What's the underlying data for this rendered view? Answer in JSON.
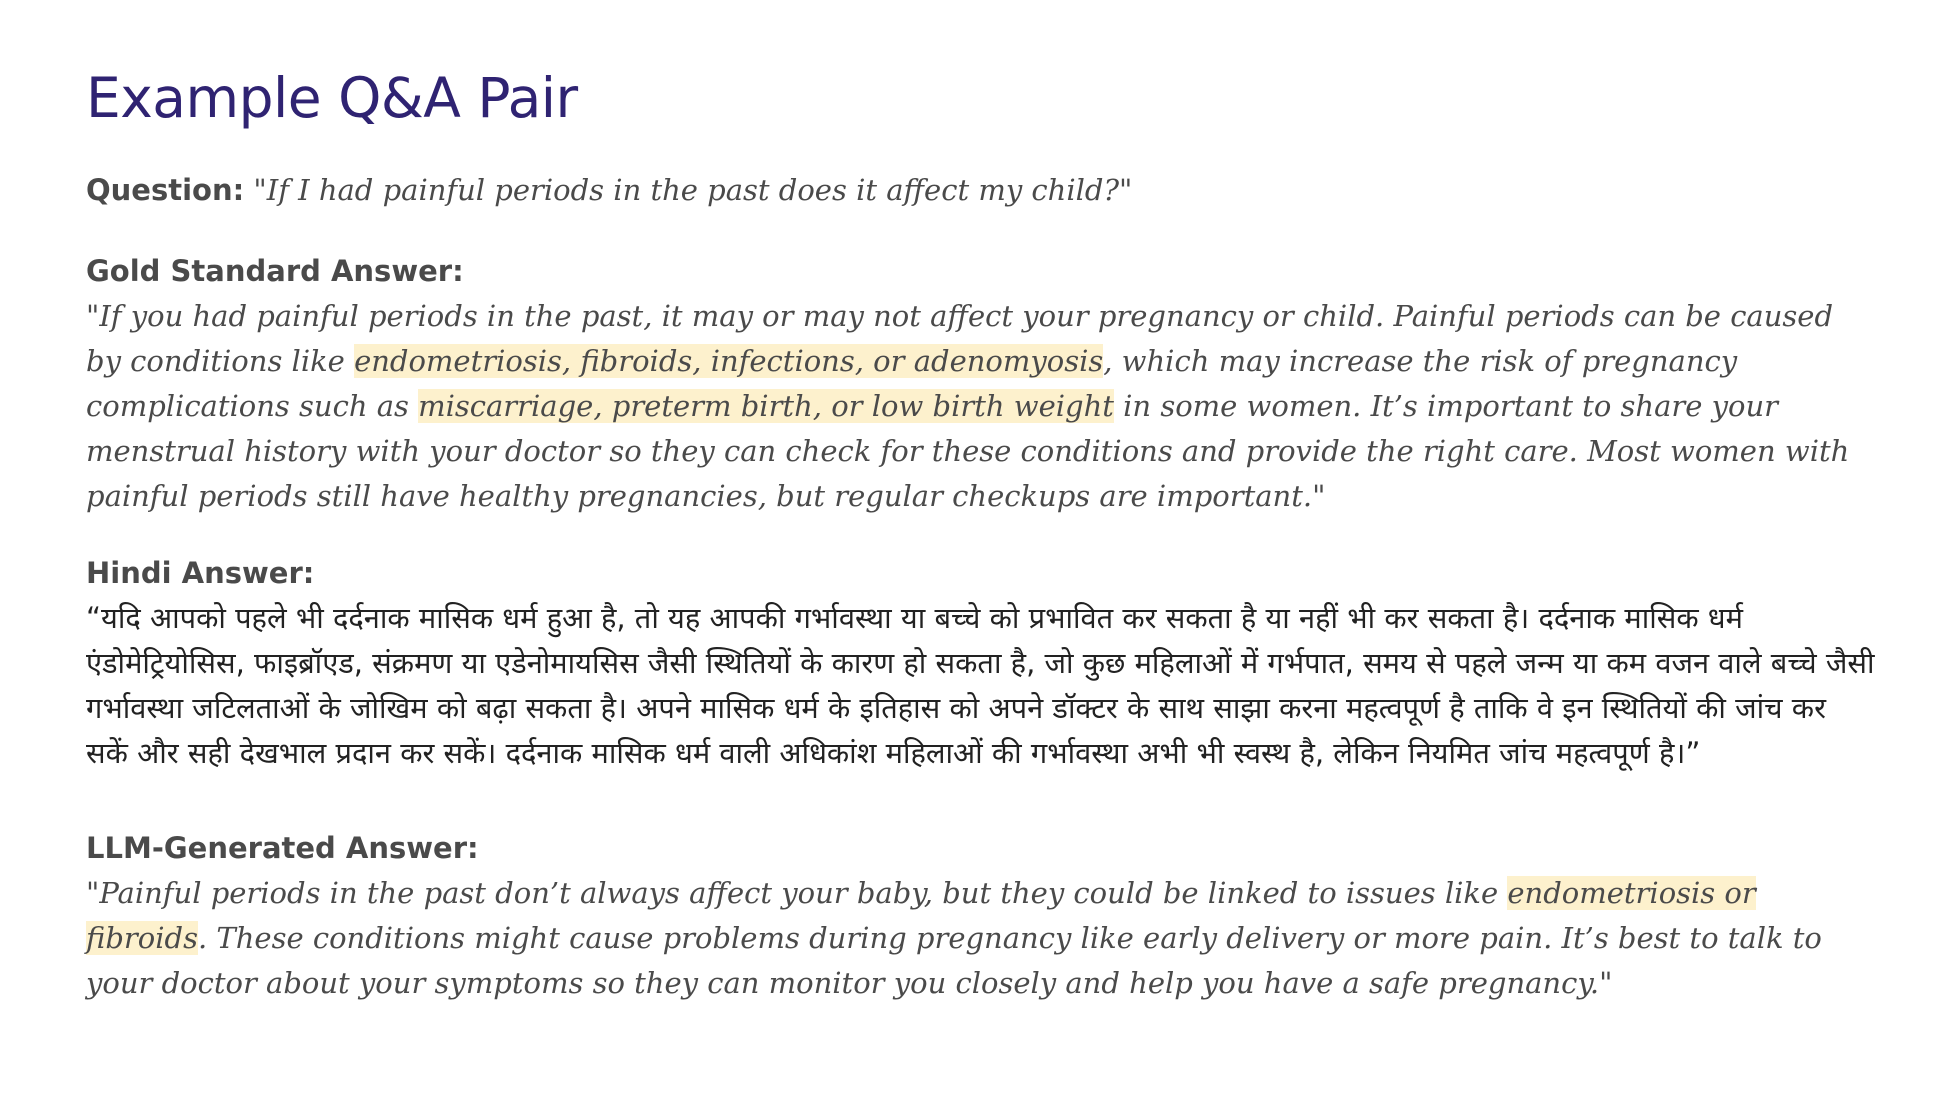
{
  "title": "Example Q&A Pair",
  "question": {
    "label": "Question:",
    "text": " \"If I had painful periods in the past does it affect my child?\""
  },
  "gold": {
    "label": "Gold Standard Answer:",
    "part1": " \"If you had painful periods in the past, it may or may not affect your pregnancy or child. Painful periods can be caused by conditions like ",
    "hl1": "endometriosis, fibroids, infections, or adenomyosis",
    "part2": ", which may increase the risk of pregnancy complications such as ",
    "hl2": "miscarriage, preterm birth, or low birth weight",
    "part3": " in some women. It’s important to share your menstrual history with your doctor so they can check for these conditions and provide the right care. Most women with painful periods still have healthy pregnancies, but regular checkups are important.\""
  },
  "hindi": {
    "label": "Hindi Answer:",
    "text": "“यदि आपको पहले भी दर्दनाक मासिक धर्म हुआ है, तो यह आपकी गर्भावस्था या बच्चे को प्रभावित कर सकता है या नहीं भी कर सकता है। दर्दनाक मासिक धर्म एंडोमेट्रियोसिस, फाइब्रॉएड, संक्रमण या एडेनोमायसिस जैसी स्थितियों के कारण हो सकता है, जो कुछ महिलाओं में गर्भपात, समय से पहले जन्म या कम वजन वाले बच्चे जैसी गर्भावस्था जटिलताओं के जोखिम को बढ़ा सकता है। अपने मासिक धर्म के इतिहास को अपने डॉक्टर के साथ साझा करना महत्वपूर्ण है ताकि वे इन स्थितियों की जांच कर सकें और सही देखभाल प्रदान कर सकें। दर्दनाक मासिक धर्म वाली अधिकांश महिलाओं की गर्भावस्था अभी भी स्वस्थ है, लेकिन नियमित जांच महत्वपूर्ण है।”"
  },
  "llm": {
    "label": "LLM-Generated Answer:",
    "part1": " \"Painful periods in the past don’t always affect your baby, but they could be linked to issues like ",
    "hl1": "endometriosis or fibroids",
    "part2": ". These conditions might cause problems during pregnancy like early delivery or more pain. It’s best to talk to your doctor about your symptoms so they can monitor you closely and help you have a safe pregnancy.\""
  },
  "colors": {
    "title": "#2f2372",
    "highlight": "#fdf1cd",
    "text": "#4a4a4a"
  }
}
